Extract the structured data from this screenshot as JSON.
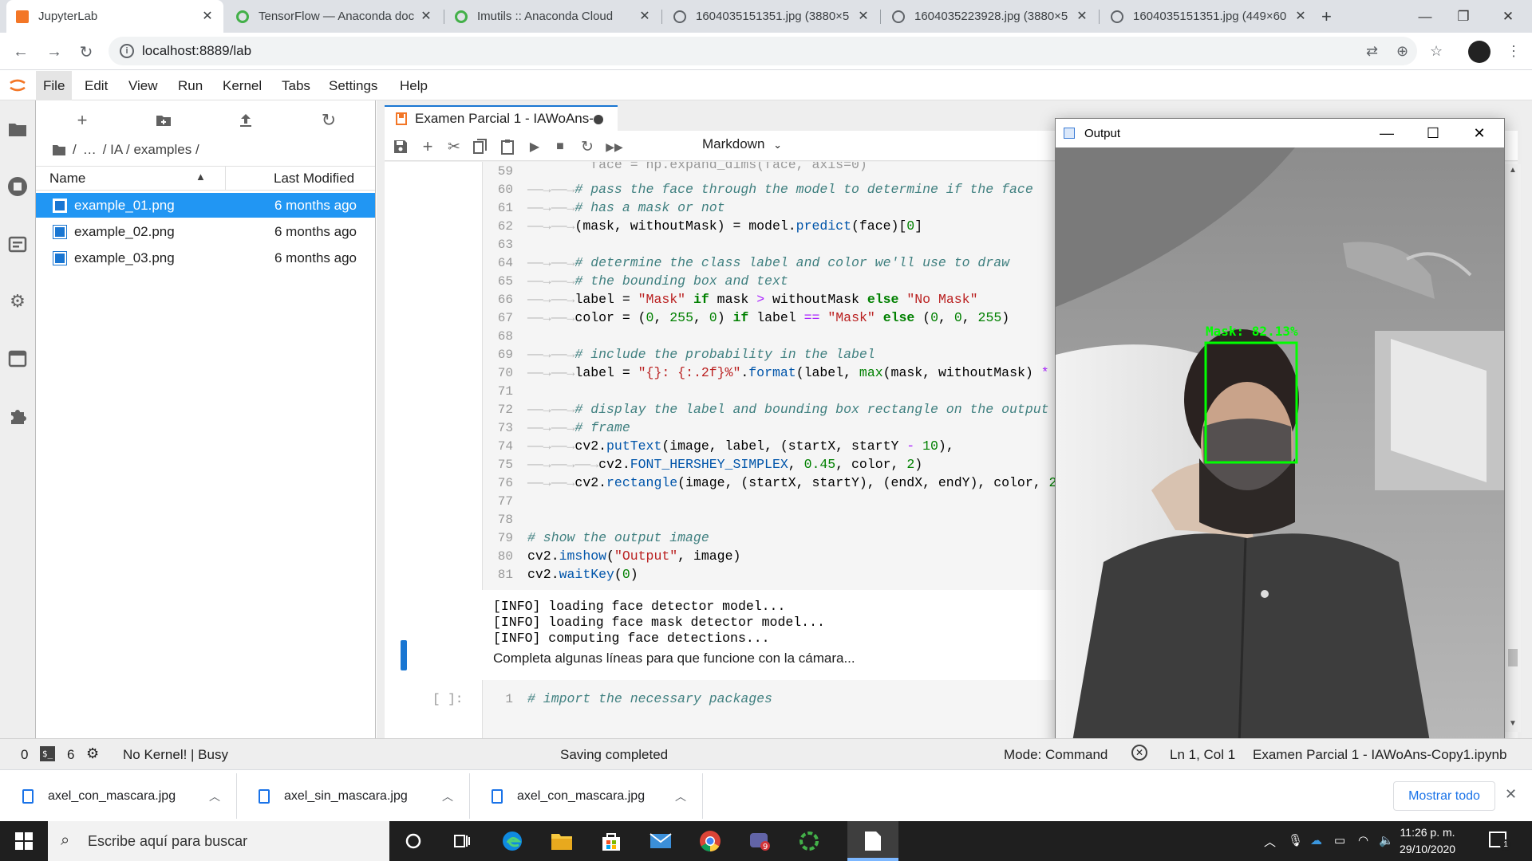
{
  "browser": {
    "tabs": [
      {
        "title": "JupyterLab",
        "color": "#f37626"
      },
      {
        "title": "TensorFlow — Anaconda doc",
        "color": "#43b049"
      },
      {
        "title": "Imutils :: Anaconda Cloud",
        "color": "#43b049"
      },
      {
        "title": "1604035151351.jpg (3880×5",
        "color": "#5f6368"
      },
      {
        "title": "1604035223928.jpg (3880×5",
        "color": "#5f6368"
      },
      {
        "title": "1604035151351.jpg (449×60",
        "color": "#5f6368"
      }
    ],
    "url": "localhost:8889/lab"
  },
  "menu": [
    "File",
    "Edit",
    "View",
    "Run",
    "Kernel",
    "Tabs",
    "Settings",
    "Help"
  ],
  "filebrowser": {
    "breadcrumb": [
      "/",
      "…",
      "/ IA / examples /"
    ],
    "col_name": "Name",
    "col_modified": "Last Modified",
    "files": [
      {
        "name": "example_01.png",
        "modified": "6 months ago"
      },
      {
        "name": "example_02.png",
        "modified": "6 months ago"
      },
      {
        "name": "example_03.png",
        "modified": "6 months ago"
      }
    ]
  },
  "notebook": {
    "tab_title": "Examen Parcial 1 - IAWoAns-",
    "cell_type": "Markdown",
    "output_lines": "[INFO] loading face detector model...\n[INFO] loading face mask detector model...\n[INFO] computing face detections...",
    "markdown_text": "Completa algunas líneas para que funcione con la cámara...",
    "prompt2": "[ ]:",
    "line2_number": "1"
  },
  "output_window": {
    "title": "Output",
    "label": "Mask: 82.13%",
    "accent": "#00ff00"
  },
  "statusbar": {
    "n1": "0",
    "n2": "6",
    "kernel": "No Kernel! | Busy",
    "saving": "Saving completed",
    "mode": "Mode: Command",
    "position": "Ln 1, Col 1",
    "filename": "Examen Parcial 1 - IAWoAns-Copy1.ipynb"
  },
  "downloads": {
    "items": [
      "axel_con_mascara.jpg",
      "axel_sin_mascara.jpg",
      "axel_con_mascara.jpg"
    ],
    "show_all": "Mostrar todo"
  },
  "taskbar": {
    "search_placeholder": "Escribe aquí para buscar",
    "time": "11:26 p. m.",
    "date": "29/10/2020",
    "notification_count": "1"
  }
}
